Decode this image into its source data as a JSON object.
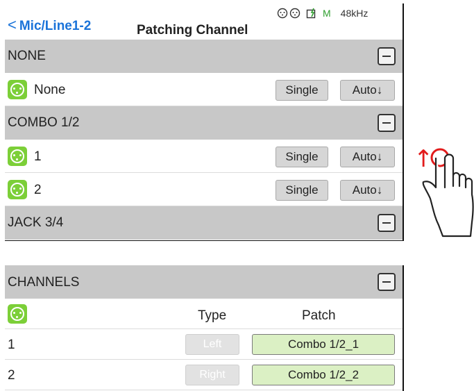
{
  "header": {
    "back_label": "Mic/Line1-2",
    "back_chevron": "<",
    "title": "Patching Channel",
    "status_m": "M",
    "sample_rate": "48kHz"
  },
  "sections": {
    "none": {
      "label": "NONE"
    },
    "combo": {
      "label": "COMBO 1/2"
    },
    "jack": {
      "label": "JACK 3/4"
    }
  },
  "rows": {
    "none": {
      "label": "None",
      "single": "Single",
      "auto": "Auto↓"
    },
    "r1": {
      "label": "1",
      "single": "Single",
      "auto": "Auto↓"
    },
    "r2": {
      "label": "2",
      "single": "Single",
      "auto": "Auto↓"
    }
  },
  "gesture": {
    "arrow": "↑",
    "icon": "hand-swipe-up"
  },
  "channels": {
    "header": "CHANNELS",
    "col_type": "Type",
    "col_patch": "Patch",
    "rows": [
      {
        "num": "1",
        "type": "Left",
        "patch": "Combo 1/2_1"
      },
      {
        "num": "2",
        "type": "Right",
        "patch": "Combo 1/2_2"
      }
    ]
  },
  "colors": {
    "accent": "#1a73d9",
    "section_bg": "#c8c8c8",
    "xlr_green": "#7ccf38",
    "patch_green": "#dbf0c4",
    "gesture_red": "#e21b1b"
  }
}
